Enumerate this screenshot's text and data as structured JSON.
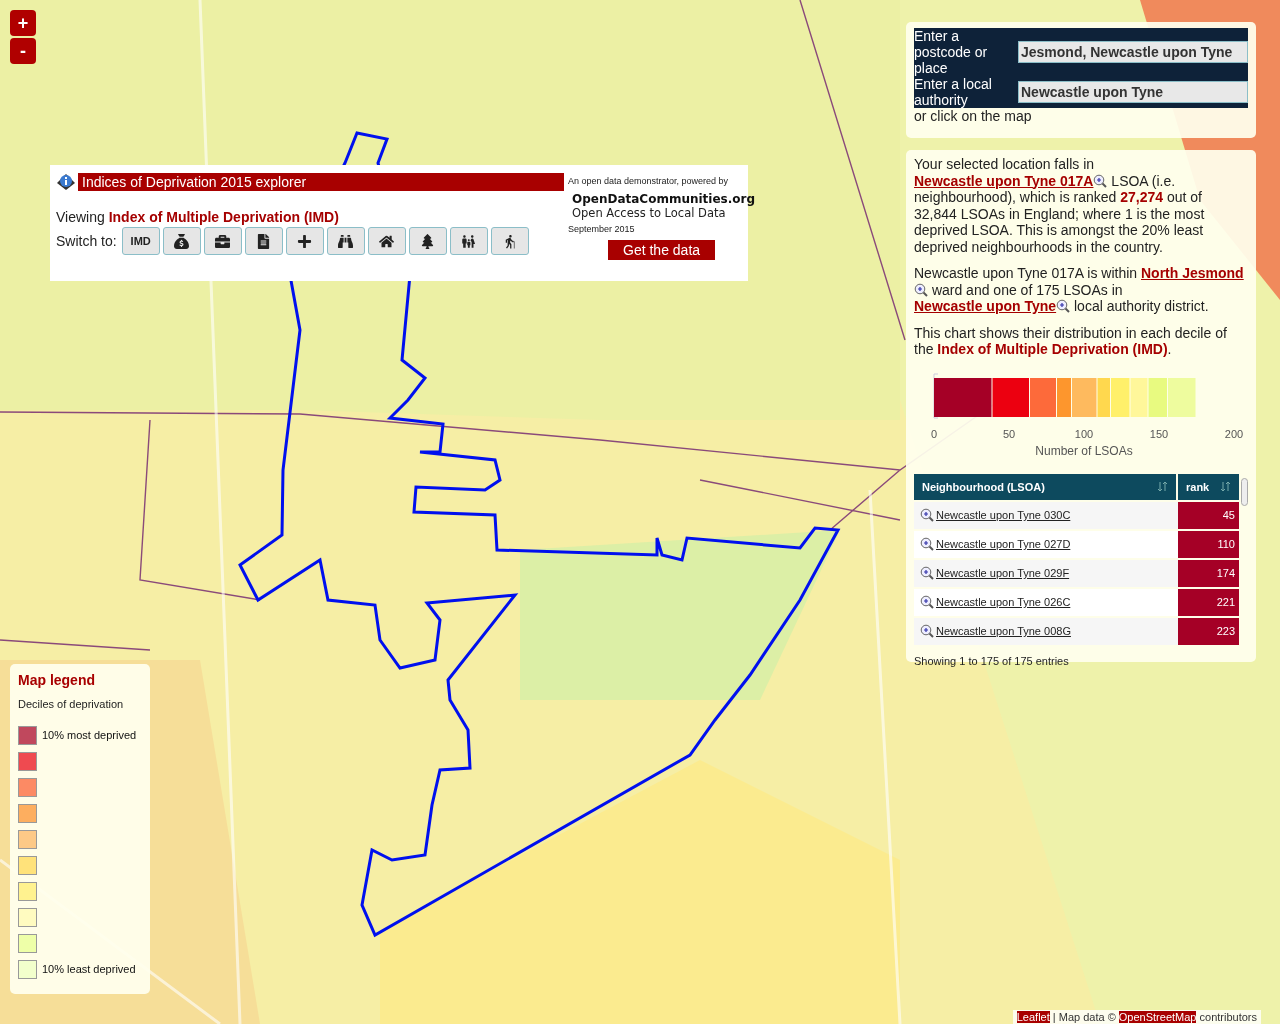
{
  "zoom_controls": [
    "+",
    "-"
  ],
  "header": {
    "title": "Indices of Deprivation 2015 explorer",
    "viewing": "Viewing **Index of Multiple Deprivation (IMD)**",
    "switch_label": "Switch to:",
    "switch_buttons": [
      {
        "kind": "text",
        "label": "IMD"
      },
      {
        "kind": "income"
      },
      {
        "kind": "employment"
      },
      {
        "kind": "education"
      },
      {
        "kind": "health"
      },
      {
        "kind": "crime"
      },
      {
        "kind": "housing"
      },
      {
        "kind": "environment"
      },
      {
        "kind": "children"
      },
      {
        "kind": "older"
      }
    ],
    "powered_by": "An open data demonstrator, powered by",
    "brand": "OpenDataCommunities.org",
    "brand_tagline": "Open Access to Local Data",
    "date": "September 2015",
    "data_button": "Get the data"
  },
  "search": {
    "place_label": "Enter a postcode or place",
    "place_value": "Jesmond, Newcastle upon Tyne",
    "authority_label": "Enter a local authority",
    "authority_value": "Newcastle upon Tyne",
    "hint": "or click on the map"
  },
  "info": {
    "paragraphs": [
      [
        {
          "kind": "text",
          "text": "Your selected location falls in "
        },
        {
          "kind": "link",
          "text": "Newcastle upon Tyne 017A"
        },
        {
          "kind": "text",
          "text": " LSOA (i.e. neighbourhood), which is ranked **27,274** out of 32,844 LSOAs in England; where 1 is the most deprived LSOA. This is amongst the 20% least deprived neighbourhoods in the country."
        }
      ],
      [
        {
          "kind": "text",
          "text": "Newcastle upon Tyne 017A is within "
        },
        {
          "kind": "link",
          "text": "North Jesmond"
        },
        {
          "kind": "text",
          "text": " ward and one of 175 LSOAs in "
        },
        {
          "kind": "link",
          "text": "Newcastle upon Tyne"
        },
        {
          "kind": "text",
          "text": " local authority district."
        }
      ],
      [
        {
          "kind": "text",
          "text": "This chart shows their distribution in each decile of the **Index of Multiple Deprivation (IMD)**."
        }
      ]
    ],
    "chart_data": {
      "type": "bar",
      "orientation": "horizontal",
      "stacked": true,
      "xlabel": "Number of LSOAs",
      "xlim": [
        0,
        200
      ],
      "xticks": [
        0,
        50,
        100,
        150,
        200
      ],
      "series": [
        {
          "color": "#a50026",
          "values": [
            39
          ]
        },
        {
          "color": "#ec0010",
          "values": [
            25
          ]
        },
        {
          "color": "#fd6a3a",
          "values": [
            18
          ]
        },
        {
          "color": "#fd962d",
          "values": [
            10
          ]
        },
        {
          "color": "#feba5e",
          "values": [
            17
          ]
        },
        {
          "color": "#ffd84e",
          "values": [
            9
          ]
        },
        {
          "color": "#fff06a",
          "values": [
            13
          ]
        },
        {
          "color": "#fff79a",
          "values": [
            12
          ]
        },
        {
          "color": "#e8fa80",
          "values": [
            13
          ]
        },
        {
          "color": "#eefc9e",
          "values": [
            19
          ]
        }
      ]
    },
    "table": {
      "columns": [
        "Neighbourhood (LSOA)",
        "rank"
      ],
      "rows": [
        {
          "name": "Newcastle upon Tyne 030C",
          "rank": "45"
        },
        {
          "name": "Newcastle upon Tyne 027D",
          "rank": "110"
        },
        {
          "name": "Newcastle upon Tyne 029F",
          "rank": "174"
        },
        {
          "name": "Newcastle upon Tyne 026C",
          "rank": "221"
        },
        {
          "name": "Newcastle upon Tyne 008G",
          "rank": "223"
        }
      ],
      "footer": "Showing 1 to 175 of 175 entries"
    }
  },
  "legend": {
    "title": "Map legend",
    "subtitle": "Deciles of deprivation",
    "items": [
      {
        "color": "#c0485d",
        "label": "10% most deprived"
      },
      {
        "color": "#ef4a50"
      },
      {
        "color": "#fc8a64"
      },
      {
        "color": "#fdae5f"
      },
      {
        "color": "#fdc987"
      },
      {
        "color": "#ffe27a"
      },
      {
        "color": "#fff28f"
      },
      {
        "color": "#fffbc0"
      },
      {
        "color": "#eeffa8"
      },
      {
        "color": "#f2ffcc",
        "label": "10% least deprived"
      }
    ]
  },
  "attribution": [
    {
      "kind": "link",
      "text": "Leaflet"
    },
    {
      "kind": "text",
      "text": " | Map data © "
    },
    {
      "kind": "link",
      "text": "OpenStreetMap"
    },
    {
      "kind": "text",
      "text": " contributors"
    }
  ]
}
